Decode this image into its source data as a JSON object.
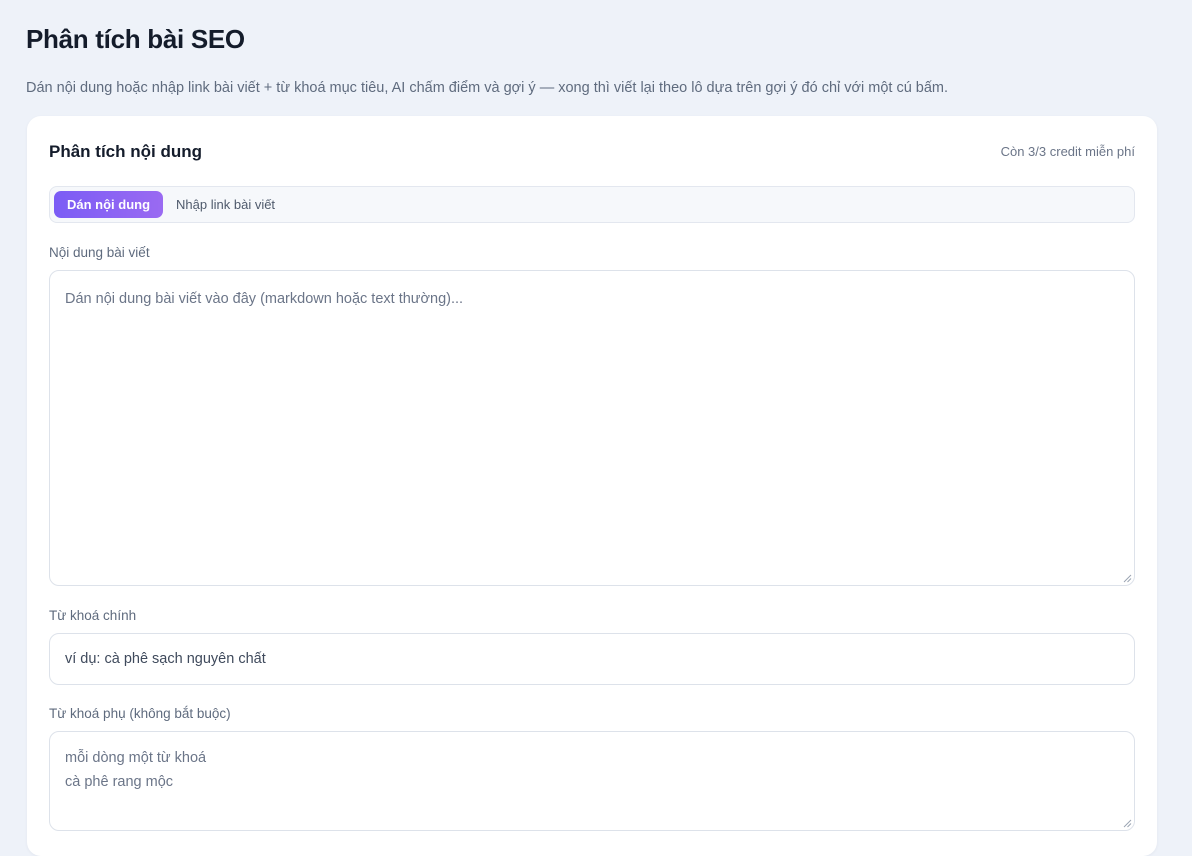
{
  "page": {
    "title": "Phân tích bài SEO",
    "subtitle": "Dán nội dung hoặc nhập link bài viết + từ khoá mục tiêu, AI chấm điểm và gợi ý — xong thì viết lại theo lô dựa trên gợi ý đó chỉ với một cú bấm."
  },
  "card": {
    "title": "Phân tích nội dung",
    "credits": "Còn 3/3 credit miễn phí",
    "tabs": [
      {
        "label": "Dán nội dung",
        "active": true
      },
      {
        "label": "Nhập link bài viết",
        "active": false
      }
    ]
  },
  "form": {
    "content": {
      "label": "Nội dung bài viết",
      "placeholder": "Dán nội dung bài viết vào đây (markdown hoặc text thường)..."
    },
    "main_keyword": {
      "label": "Từ khoá chính",
      "placeholder": "ví dụ: cà phê sạch nguyên chất"
    },
    "secondary_keywords": {
      "label": "Từ khoá phụ (không bắt buộc)",
      "placeholder_line1": "mỗi dòng một từ khoá",
      "placeholder_line2": "cà phê rang mộc"
    }
  },
  "colors": {
    "accent_start": "#7b5cf5",
    "accent_end": "#9a6af2",
    "background": "#eef2f9"
  }
}
